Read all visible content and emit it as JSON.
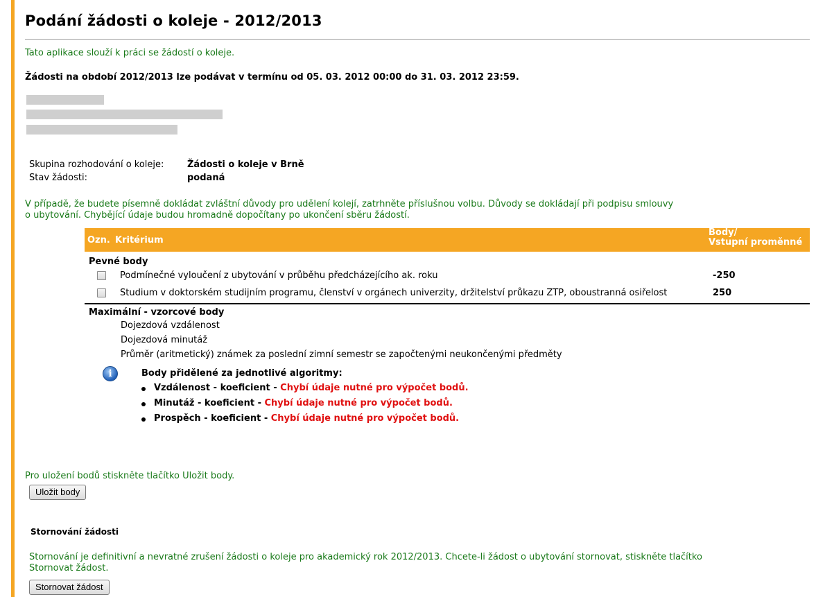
{
  "page": {
    "title": "Podání žádosti o koleje - 2012/2013",
    "intro": "Tato aplikace slouží k práci se žádostí o koleje.",
    "deadline": "Žádosti na období 2012/2013 lze podávat v termínu od 05. 03. 2012 00:00 do 31. 03. 2012 23:59."
  },
  "info": {
    "group_label": "Skupina rozhodování o koleje:",
    "group_value": "Žádosti o koleje v Brně",
    "status_label": "Stav žádosti:",
    "status_value": "podaná"
  },
  "notice": {
    "line1": "V případě, že budete písemně dokládat zvláštní důvody pro udělení kolejí, zatrhněte příslušnou volbu. Důvody se dokládají při podpisu smlouvy",
    "line2": "o ubytování. Chybějící údaje budou hromadně dopočítany po ukončení sběru žádostí."
  },
  "table": {
    "col_ozn": "Ozn.",
    "col_criterion": "Kritérium",
    "col_points_1": "Body/",
    "col_points_2": "Vstupní proměnné",
    "fixed_heading": "Pevné body",
    "fixed_rows": [
      {
        "label": "Podmínečné vyloučení z ubytování v průběhu předcházejícího ak. roku",
        "points": "-250",
        "checked": false
      },
      {
        "label": "Studium v doktorském studijním programu, členství v orgánech univerzity, držitelství průkazu ZTP, oboustranná osiřelost",
        "points": "250",
        "checked": false
      }
    ],
    "max_heading": "Maximální - vzorcové body",
    "max_rows": [
      "Dojezdová vzdálenost",
      "Dojezdová minutáž",
      "Průměr (aritmetický) známek za poslední zimní semestr se započtenými neukončenými předměty"
    ],
    "algo_heading": "Body přidělené za jednotlivé algoritmy:",
    "algo_rows": [
      {
        "name": "Vzdálenost",
        "coef": "koeficient",
        "error": "Chybí údaje nutné pro výpočet bodů."
      },
      {
        "name": "Minutáž",
        "coef": "koeficient",
        "error": "Chybí údaje nutné pro výpočet bodů."
      },
      {
        "name": "Prospěch",
        "coef": "koeficient",
        "error": "Chybí údaje nutné pro výpočet bodů."
      }
    ]
  },
  "save": {
    "hint": "Pro uložení bodů stiskněte tlačítko Uložit body.",
    "button": "Uložit body"
  },
  "cancel": {
    "heading": "Stornování žádosti",
    "text1": "Stornování je definitivní a nevratné zrušení žádosti o koleje pro akademický rok 2012/2013. Chcete-li žádost o ubytování stornovat, stiskněte tlačítko",
    "text2": "Stornovat žádost.",
    "button": "Stornovat žádost"
  },
  "colors": {
    "accent": "#f5a623",
    "green_text": "#1a7a1a",
    "error_red": "#e01010"
  }
}
